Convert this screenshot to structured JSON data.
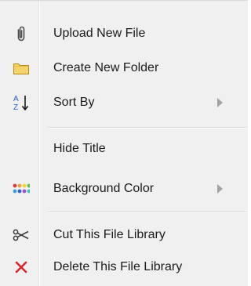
{
  "menu": {
    "items": [
      {
        "label": "Upload New File",
        "icon": "paperclip-icon",
        "has_submenu": false
      },
      {
        "label": "Create New Folder",
        "icon": "folder-icon",
        "has_submenu": false
      },
      {
        "label": "Sort By",
        "icon": "sort-az-icon",
        "has_submenu": true
      },
      {
        "label": "Hide Title",
        "icon": "",
        "has_submenu": false
      },
      {
        "label": "Background Color",
        "icon": "color-palette-icon",
        "has_submenu": true
      },
      {
        "label": "Cut This File Library",
        "icon": "scissors-icon",
        "has_submenu": false
      },
      {
        "label": "Delete This File Library",
        "icon": "delete-x-icon",
        "has_submenu": false
      }
    ]
  },
  "colors": {
    "menu_background": "#f0f0f0",
    "text": "#1b1b1b",
    "folder": "#f2c94c",
    "delete_red": "#d6262b",
    "sort_blue": "#2a63c9"
  }
}
